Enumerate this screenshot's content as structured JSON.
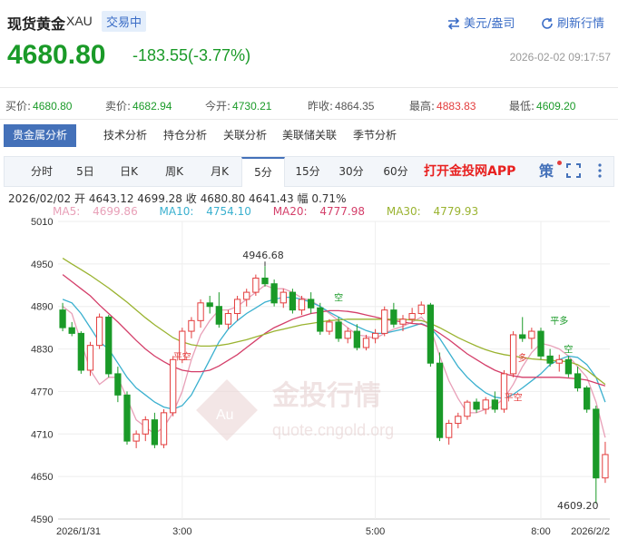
{
  "header": {
    "name": "现货黄金",
    "code": "XAU",
    "status": "交易中",
    "currency_link": "美元/盎司",
    "refresh_link": "刷新行情"
  },
  "quote": {
    "price": "4680.80",
    "change": "-183.55(-3.77%)",
    "time": "2026-02-02 09:17:57"
  },
  "stats": [
    {
      "label": "买价:",
      "value": "4680.80",
      "tone": "green"
    },
    {
      "label": "卖价:",
      "value": "4682.94",
      "tone": "green"
    },
    {
      "label": "今开:",
      "value": "4730.21",
      "tone": "green"
    },
    {
      "label": "昨收:",
      "value": "4864.35",
      "tone": "plain"
    },
    {
      "label": "最高:",
      "value": "4883.83",
      "tone": "red"
    },
    {
      "label": "最低:",
      "value": "4609.20",
      "tone": "green"
    }
  ],
  "tabs": [
    "贵金属分析",
    "技术分析",
    "持仓分析",
    "关联分析",
    "美联储关联",
    "季节分析"
  ],
  "periods": [
    "分时",
    "5日",
    "日K",
    "周K",
    "月K",
    "5分",
    "15分",
    "30分",
    "60分"
  ],
  "active_period": "5分",
  "app_link": "打开金投网APP",
  "strategy_icon": "策",
  "icons": {
    "fullscreen": "fullscreen-icon",
    "more": "more-icon",
    "currency": "swap-icon",
    "refresh": "refresh-icon"
  },
  "bar_info": {
    "date": "2026/02/02",
    "open_label": "开",
    "open": "4643.12",
    "high": "4699.28",
    "close_label": "收",
    "close": "4680.80",
    "low": "4641.43",
    "amp_label": "幅",
    "amp": "0.71%"
  },
  "ma_info": [
    {
      "label": "MA5:",
      "value": "4699.86",
      "color": "#e8a0b8"
    },
    {
      "label": "MA10:",
      "value": "4754.10",
      "color": "#3ab0cf"
    },
    {
      "label": "MA20:",
      "value": "4777.98",
      "color": "#d43f6a"
    },
    {
      "label": "MA30:",
      "value": "4779.93",
      "color": "#9ab330"
    }
  ],
  "colors": {
    "up": "#e33d3d",
    "down": "#1a9a28",
    "accent": "#4471b9"
  },
  "watermark": {
    "text": "金投行情",
    "url": "quote.cngold.org",
    "logo": "Au"
  },
  "chart_data": {
    "type": "candlestick",
    "y_ticks": [
      4590,
      4650,
      4710,
      4770,
      4830,
      4890,
      4950,
      5010
    ],
    "ylim": [
      4590,
      5010
    ],
    "x_labels": [
      "2026/1/31",
      "3:00",
      "5:00",
      "8:00",
      "2026/2/2"
    ],
    "annotations": [
      {
        "text": "4946.68",
        "kind": "high"
      },
      {
        "text": "4609.20",
        "kind": "low"
      },
      {
        "text": "平空",
        "color": "#e33d3d"
      },
      {
        "text": "空",
        "color": "#1a9a28"
      },
      {
        "text": "多",
        "color": "#e33d3d"
      },
      {
        "text": "平空",
        "color": "#e33d3d"
      },
      {
        "text": "平多",
        "color": "#1a9a28"
      },
      {
        "text": "空",
        "color": "#1a9a28"
      }
    ],
    "candles": [
      [
        4885,
        4895,
        4855,
        4860
      ],
      [
        4860,
        4868,
        4848,
        4852
      ],
      [
        4852,
        4855,
        4795,
        4800
      ],
      [
        4800,
        4840,
        4792,
        4835
      ],
      [
        4835,
        4880,
        4830,
        4875
      ],
      [
        4875,
        4878,
        4790,
        4795
      ],
      [
        4795,
        4805,
        4755,
        4765
      ],
      [
        4765,
        4770,
        4695,
        4700
      ],
      [
        4700,
        4715,
        4690,
        4710
      ],
      [
        4710,
        4735,
        4700,
        4730
      ],
      [
        4730,
        4740,
        4690,
        4695
      ],
      [
        4695,
        4745,
        4690,
        4740
      ],
      [
        4740,
        4820,
        4735,
        4815
      ],
      [
        4815,
        4860,
        4810,
        4855
      ],
      [
        4855,
        4875,
        4845,
        4870
      ],
      [
        4870,
        4900,
        4860,
        4895
      ],
      [
        4895,
        4905,
        4880,
        4890
      ],
      [
        4890,
        4910,
        4860,
        4865
      ],
      [
        4865,
        4885,
        4858,
        4880
      ],
      [
        4880,
        4905,
        4870,
        4900
      ],
      [
        4900,
        4915,
        4890,
        4910
      ],
      [
        4910,
        4935,
        4905,
        4930
      ],
      [
        4930,
        4947,
        4918,
        4922
      ],
      [
        4922,
        4928,
        4890,
        4895
      ],
      [
        4895,
        4915,
        4888,
        4910
      ],
      [
        4910,
        4915,
        4880,
        4885
      ],
      [
        4885,
        4905,
        4878,
        4900
      ],
      [
        4900,
        4910,
        4880,
        4888
      ],
      [
        4888,
        4895,
        4850,
        4855
      ],
      [
        4855,
        4872,
        4850,
        4868
      ],
      [
        4868,
        4875,
        4840,
        4845
      ],
      [
        4845,
        4860,
        4838,
        4855
      ],
      [
        4855,
        4865,
        4828,
        4832
      ],
      [
        4832,
        4850,
        4828,
        4845
      ],
      [
        4845,
        4858,
        4838,
        4852
      ],
      [
        4852,
        4890,
        4848,
        4885
      ],
      [
        4885,
        4895,
        4860,
        4865
      ],
      [
        4865,
        4878,
        4855,
        4872
      ],
      [
        4872,
        4888,
        4866,
        4880
      ],
      [
        4880,
        4897,
        4878,
        4892
      ],
      [
        4892,
        4895,
        4805,
        4810
      ],
      [
        4810,
        4825,
        4700,
        4705
      ],
      [
        4705,
        4730,
        4695,
        4725
      ],
      [
        4725,
        4740,
        4718,
        4735
      ],
      [
        4735,
        4758,
        4730,
        4755
      ],
      [
        4755,
        4760,
        4740,
        4745
      ],
      [
        4745,
        4762,
        4738,
        4758
      ],
      [
        4758,
        4770,
        4740,
        4745
      ],
      [
        4745,
        4800,
        4740,
        4795
      ],
      [
        4795,
        4855,
        4790,
        4850
      ],
      [
        4850,
        4875,
        4840,
        4845
      ],
      [
        4845,
        4860,
        4830,
        4855
      ],
      [
        4855,
        4860,
        4815,
        4820
      ],
      [
        4820,
        4830,
        4805,
        4810
      ],
      [
        4810,
        4822,
        4798,
        4815
      ],
      [
        4815,
        4820,
        4790,
        4795
      ],
      [
        4795,
        4805,
        4770,
        4775
      ],
      [
        4775,
        4778,
        4740,
        4745
      ],
      [
        4745,
        4750,
        4612,
        4648
      ],
      [
        4648,
        4699,
        4641,
        4681
      ]
    ],
    "ma": {
      "MA5": [
        4890,
        4880,
        4840,
        4800,
        4780,
        4790,
        4790,
        4760,
        4730,
        4720,
        4710,
        4720,
        4740,
        4770,
        4815,
        4850,
        4870,
        4885,
        4885,
        4890,
        4900,
        4910,
        4920,
        4915,
        4915,
        4910,
        4902,
        4898,
        4890,
        4880,
        4870,
        4860,
        4850,
        4848,
        4845,
        4852,
        4858,
        4862,
        4868,
        4875,
        4860,
        4820,
        4785,
        4760,
        4740,
        4740,
        4745,
        4750,
        4760,
        4780,
        4805,
        4825,
        4838,
        4835,
        4830,
        4820,
        4805,
        4790,
        4755,
        4705
      ],
      "MA10": [
        4900,
        4895,
        4880,
        4860,
        4840,
        4830,
        4810,
        4790,
        4775,
        4765,
        4755,
        4748,
        4745,
        4750,
        4765,
        4790,
        4815,
        4840,
        4858,
        4870,
        4880,
        4888,
        4896,
        4900,
        4903,
        4903,
        4900,
        4896,
        4890,
        4882,
        4875,
        4868,
        4862,
        4856,
        4852,
        4852,
        4855,
        4858,
        4862,
        4866,
        4860,
        4845,
        4825,
        4805,
        4790,
        4778,
        4768,
        4762,
        4760,
        4766,
        4775,
        4785,
        4795,
        4808,
        4815,
        4820,
        4818,
        4808,
        4790,
        4755
      ],
      "MA20": [
        4935,
        4925,
        4915,
        4905,
        4892,
        4880,
        4868,
        4855,
        4842,
        4830,
        4820,
        4812,
        4805,
        4800,
        4798,
        4798,
        4800,
        4806,
        4814,
        4822,
        4832,
        4842,
        4852,
        4860,
        4866,
        4872,
        4876,
        4880,
        4882,
        4884,
        4884,
        4883,
        4881,
        4878,
        4875,
        4872,
        4870,
        4868,
        4866,
        4865,
        4860,
        4852,
        4843,
        4833,
        4823,
        4815,
        4807,
        4800,
        4795,
        4792,
        4790,
        4790,
        4790,
        4790,
        4790,
        4789,
        4788,
        4786,
        4782,
        4778
      ],
      "MA30": [
        4958,
        4950,
        4942,
        4934,
        4925,
        4916,
        4906,
        4896,
        4885,
        4874,
        4864,
        4855,
        4846,
        4840,
        4836,
        4834,
        4834,
        4835,
        4837,
        4840,
        4843,
        4847,
        4851,
        4855,
        4858,
        4861,
        4864,
        4866,
        4868,
        4870,
        4871,
        4872,
        4872,
        4872,
        4872,
        4872,
        4872,
        4872,
        4871,
        4870,
        4866,
        4860,
        4853,
        4846,
        4840,
        4834,
        4829,
        4825,
        4822,
        4820,
        4818,
        4816,
        4815,
        4814,
        4813,
        4812,
        4808,
        4800,
        4790,
        4780
      ]
    }
  }
}
